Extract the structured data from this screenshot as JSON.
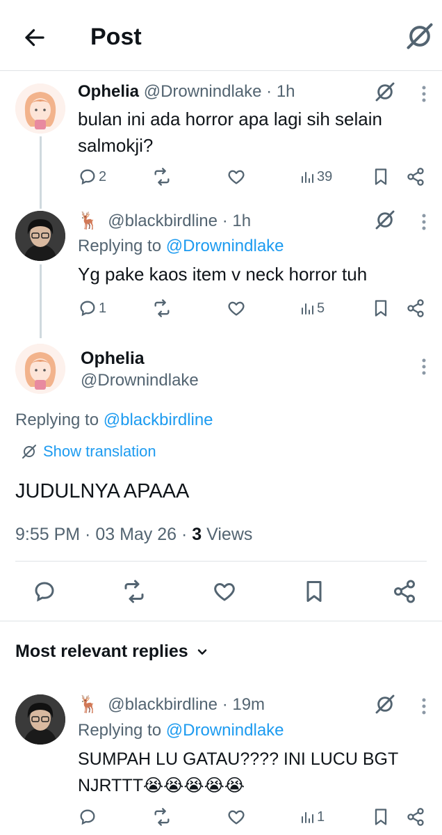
{
  "header": {
    "title": "Post"
  },
  "thread": [
    {
      "name": "Ophelia",
      "handle": "@Drownindlake",
      "time": "· 1h",
      "text_line1": "bulan ini ada horror apa lagi sih selain",
      "text_line2": "salmokji?",
      "replies": "2",
      "views": "39"
    },
    {
      "name_emoji": "🦌",
      "handle": "@blackbirdline",
      "time": "· 1h",
      "replying_label": "Replying to",
      "replying_to": "@Drownindlake",
      "text": "Yg pake kaos item v neck horror tuh",
      "replies": "1",
      "views": "5"
    }
  ],
  "main_post": {
    "name": "Ophelia",
    "handle": "@Drownindlake",
    "replying_label": "Replying to",
    "replying_to": "@blackbirdline",
    "translate_label": "Show translation",
    "text": "JUDULNYA APAAA",
    "timestamp": "9:55 PM · 03 May 26 · ",
    "views_count": "3",
    "views_label": " Views"
  },
  "replies_section": {
    "label": "Most relevant replies"
  },
  "reply": {
    "name_emoji": "🦌",
    "handle": "@blackbirdline",
    "time": "· 19m",
    "replying_label": "Replying to",
    "replying_to": "@Drownindlake",
    "text_line1": "SUMPAH LU GATAU???? INI LUCU BGT",
    "text_line2": "NJRTTT😭😭😭😭😭",
    "views": "1"
  },
  "colors": {
    "link": "#1d9bf0",
    "grey": "#536471",
    "divider": "#dfe3e6"
  }
}
